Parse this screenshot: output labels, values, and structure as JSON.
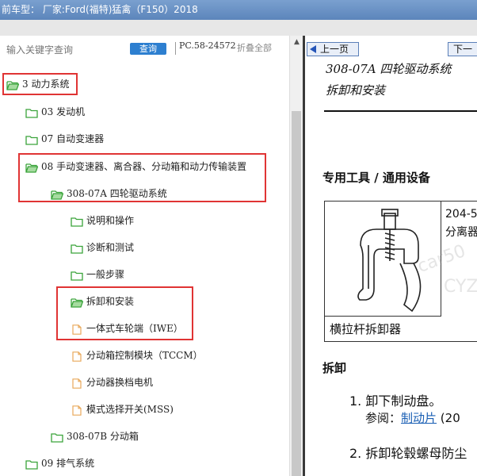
{
  "titlebar": {
    "text": "前车型： 厂家:Ford(福特)猛禽（F150）2018"
  },
  "search": {
    "placeholder": "输入关键字查询",
    "button": "查询",
    "pc_code": "PC.58-24572",
    "collapse_all": "折叠全部"
  },
  "tree": [
    {
      "label": "3 动力系统",
      "icon": "folder-open-icon"
    },
    {
      "label": "03 发动机",
      "icon": "folder-icon"
    },
    {
      "label": "07 自动变速器",
      "icon": "folder-icon"
    },
    {
      "label": "08 手动变速器、离合器、分动箱和动力传输装置",
      "icon": "folder-open-icon"
    },
    {
      "label": "308-07A 四轮驱动系统",
      "icon": "folder-open-icon"
    },
    {
      "label": "说明和操作",
      "icon": "folder-icon"
    },
    {
      "label": "诊断和测试",
      "icon": "folder-icon"
    },
    {
      "label": "一般步骤",
      "icon": "folder-icon"
    },
    {
      "label": "拆卸和安装",
      "icon": "folder-open-icon"
    },
    {
      "label": "一体式车轮端（IWE）",
      "icon": "document-icon"
    },
    {
      "label": "分动箱控制模块（TCCM）",
      "icon": "document-icon"
    },
    {
      "label": "分动器换档电机",
      "icon": "document-icon"
    },
    {
      "label": "模式选择开关(MSS)",
      "icon": "document-icon"
    },
    {
      "label": "308-07B 分动箱",
      "icon": "folder-icon"
    },
    {
      "label": "09 排气系统",
      "icon": "folder-icon"
    }
  ],
  "doc": {
    "prev": "上一页",
    "next": "下一",
    "section": "308-07A 四轮驱动系统",
    "subtitle": "拆卸和安装",
    "tools_title": "专用工具 / 通用设备",
    "tool_code": "204-5",
    "tool_code2": "分离器",
    "tool_name": "横拉杆拆卸器",
    "removal": "拆卸",
    "step1": "1. 卸下制动盘。",
    "ref_prefix": "参阅：",
    "ref_link": "制动片",
    "ref_suffix": " (20",
    "step2": "2. 拆卸轮毂螺母防尘",
    "watermark1": "car50",
    "watermark2": "CYZ"
  },
  "colors": {
    "title_bar": "#6a92c6",
    "highlight": "#e03434",
    "query_button": "#2d7fd0",
    "folder": "#3aa33a",
    "link": "#1a5fb4"
  }
}
